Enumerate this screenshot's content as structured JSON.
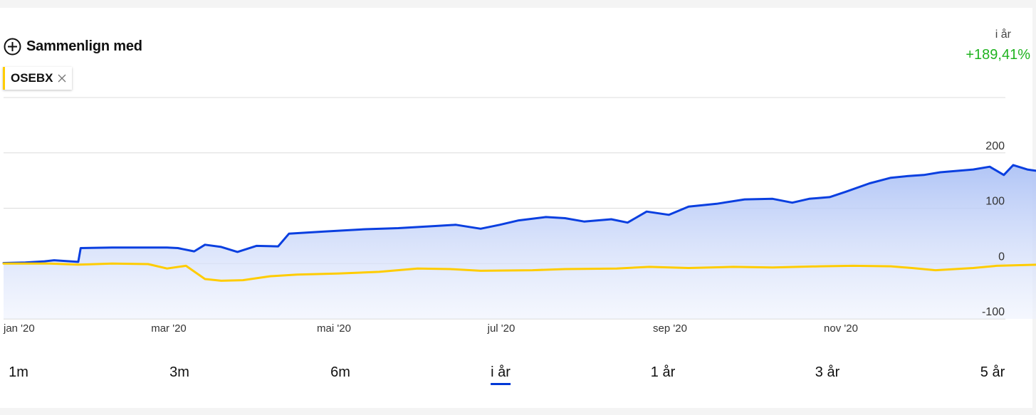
{
  "compare": {
    "label": "Sammenlign med"
  },
  "comparison_chip": {
    "label": "OSEBX",
    "color": "#ffcc00"
  },
  "period_summary": {
    "label": "i år",
    "change": "+189,41%",
    "color": "#1fb31f"
  },
  "ranges": [
    {
      "label": "1m",
      "active": false
    },
    {
      "label": "3m",
      "active": false
    },
    {
      "label": "6m",
      "active": false
    },
    {
      "label": "i år",
      "active": true
    },
    {
      "label": "1 år",
      "active": false
    },
    {
      "label": "3 år",
      "active": false
    },
    {
      "label": "5 år",
      "active": false
    }
  ],
  "chart_data": {
    "type": "line",
    "x_tick_labels": [
      "jan '20",
      "mar '20",
      "mai '20",
      "jul '20",
      "sep '20",
      "nov '20"
    ],
    "x_range": [
      "2020-01-01",
      "2020-12-31"
    ],
    "y_tick_labels": [
      "200",
      "100",
      "0",
      "-100"
    ],
    "ylim": [
      -100,
      300
    ],
    "grid": true,
    "series": [
      {
        "color": "#0a3fe0",
        "fill": true,
        "points": [
          [
            "2020-01-01",
            1
          ],
          [
            "2020-01-10",
            2
          ],
          [
            "2020-01-18",
            4
          ],
          [
            "2020-01-22",
            6
          ],
          [
            "2020-02-01",
            3
          ],
          [
            "2020-02-02",
            28
          ],
          [
            "2020-02-15",
            29
          ],
          [
            "2020-03-01",
            29
          ],
          [
            "2020-03-08",
            29
          ],
          [
            "2020-03-12",
            28
          ],
          [
            "2020-03-18",
            22
          ],
          [
            "2020-03-22",
            34
          ],
          [
            "2020-03-28",
            30
          ],
          [
            "2020-04-03",
            21
          ],
          [
            "2020-04-10",
            32
          ],
          [
            "2020-04-18",
            31
          ],
          [
            "2020-04-22",
            54
          ],
          [
            "2020-05-05",
            58
          ],
          [
            "2020-05-20",
            62
          ],
          [
            "2020-06-01",
            64
          ],
          [
            "2020-06-15",
            68
          ],
          [
            "2020-06-22",
            70
          ],
          [
            "2020-07-01",
            63
          ],
          [
            "2020-07-08",
            70
          ],
          [
            "2020-07-15",
            78
          ],
          [
            "2020-07-25",
            84
          ],
          [
            "2020-08-01",
            82
          ],
          [
            "2020-08-08",
            76
          ],
          [
            "2020-08-18",
            80
          ],
          [
            "2020-08-24",
            74
          ],
          [
            "2020-08-31",
            94
          ],
          [
            "2020-09-08",
            88
          ],
          [
            "2020-09-15",
            103
          ],
          [
            "2020-09-25",
            108
          ],
          [
            "2020-10-05",
            116
          ],
          [
            "2020-10-15",
            117
          ],
          [
            "2020-10-22",
            110
          ],
          [
            "2020-10-28",
            117
          ],
          [
            "2020-11-05",
            120
          ],
          [
            "2020-11-12",
            130
          ],
          [
            "2020-11-22",
            145
          ],
          [
            "2020-12-01",
            155
          ],
          [
            "2020-12-08",
            158
          ],
          [
            "2020-12-15",
            160
          ],
          [
            "2020-12-22",
            165
          ],
          [
            "2021-01-05",
            170
          ],
          [
            "2021-01-12",
            175
          ],
          [
            "2021-01-18",
            160
          ],
          [
            "2021-01-22",
            178
          ],
          [
            "2021-01-28",
            170
          ],
          [
            "2021-02-05",
            165
          ],
          [
            "2021-02-12",
            178
          ],
          [
            "2021-02-22",
            190
          ],
          [
            "2021-03-01",
            188
          ],
          [
            "2021-03-05",
            190
          ],
          [
            "2021-03-10",
            189
          ]
        ]
      },
      {
        "name": "OSEBX",
        "color": "#ffcc00",
        "fill": false,
        "points": [
          [
            "2020-01-01",
            0
          ],
          [
            "2020-01-20",
            0
          ],
          [
            "2020-02-01",
            -2
          ],
          [
            "2020-02-15",
            0
          ],
          [
            "2020-03-01",
            -1
          ],
          [
            "2020-03-08",
            -9
          ],
          [
            "2020-03-15",
            -4
          ],
          [
            "2020-03-22",
            -28
          ],
          [
            "2020-03-28",
            -31
          ],
          [
            "2020-04-05",
            -30
          ],
          [
            "2020-04-15",
            -23
          ],
          [
            "2020-04-25",
            -20
          ],
          [
            "2020-05-10",
            -18
          ],
          [
            "2020-05-25",
            -15
          ],
          [
            "2020-06-08",
            -9
          ],
          [
            "2020-06-20",
            -10
          ],
          [
            "2020-07-01",
            -13
          ],
          [
            "2020-07-20",
            -12
          ],
          [
            "2020-08-01",
            -10
          ],
          [
            "2020-08-20",
            -9
          ],
          [
            "2020-09-01",
            -6
          ],
          [
            "2020-09-15",
            -8
          ],
          [
            "2020-10-01",
            -6
          ],
          [
            "2020-10-15",
            -7
          ],
          [
            "2020-11-01",
            -5
          ],
          [
            "2020-11-15",
            -4
          ],
          [
            "2020-12-01",
            -5
          ],
          [
            "2020-12-10",
            -8
          ],
          [
            "2020-12-20",
            -12
          ],
          [
            "2021-01-05",
            -8
          ],
          [
            "2021-01-15",
            -4
          ],
          [
            "2021-02-01",
            -2
          ],
          [
            "2021-02-15",
            0
          ],
          [
            "2021-03-01",
            0
          ],
          [
            "2021-03-10",
            4
          ]
        ]
      }
    ]
  }
}
